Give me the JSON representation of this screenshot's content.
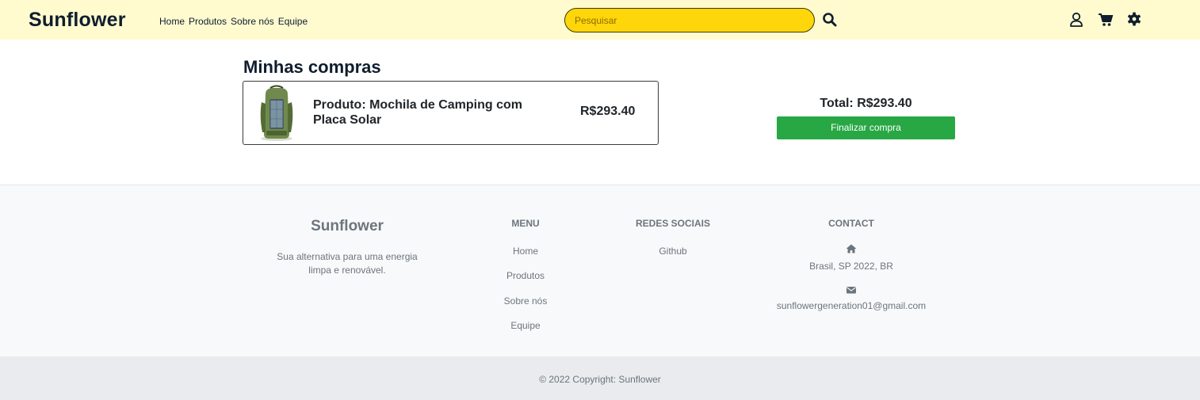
{
  "navbar": {
    "brand": "Sunflower",
    "links": [
      "Home",
      "Produtos",
      "Sobre nós",
      "Equipe"
    ],
    "search_placeholder": "Pesquisar"
  },
  "main": {
    "title": "Minhas compras",
    "cart_items": [
      {
        "name": "Produto: Mochila de Camping com Placa Solar",
        "price": "R$293.40"
      }
    ],
    "total": "Total: R$293.40",
    "checkout_label": "Finalizar compra"
  },
  "footer": {
    "brand": "Sunflower",
    "description": "Sua alternativa para uma energia limpa e renovável.",
    "menu_title": "MENU",
    "menu_links": [
      "Home",
      "Produtos",
      "Sobre nós",
      "Equipe"
    ],
    "social_title": "REDES SOCIAIS",
    "social_links": [
      "Github"
    ],
    "contact_title": "CONTACT",
    "address": "Brasil, SP 2022, BR",
    "email": "sunflowergeneration01@gmail.com",
    "copyright": "© 2022 Copyright: Sunflower"
  },
  "colors": {
    "navbar_bg": "#fffbcf",
    "search_bg": "#ffd60a",
    "checkout_button": "#28a745",
    "footer_bg": "#f8f9fa",
    "brand_text": "#0f1d2e"
  },
  "icons": [
    "search-icon",
    "user-icon",
    "cart-icon",
    "gear-icon",
    "home-icon",
    "envelope-icon"
  ]
}
